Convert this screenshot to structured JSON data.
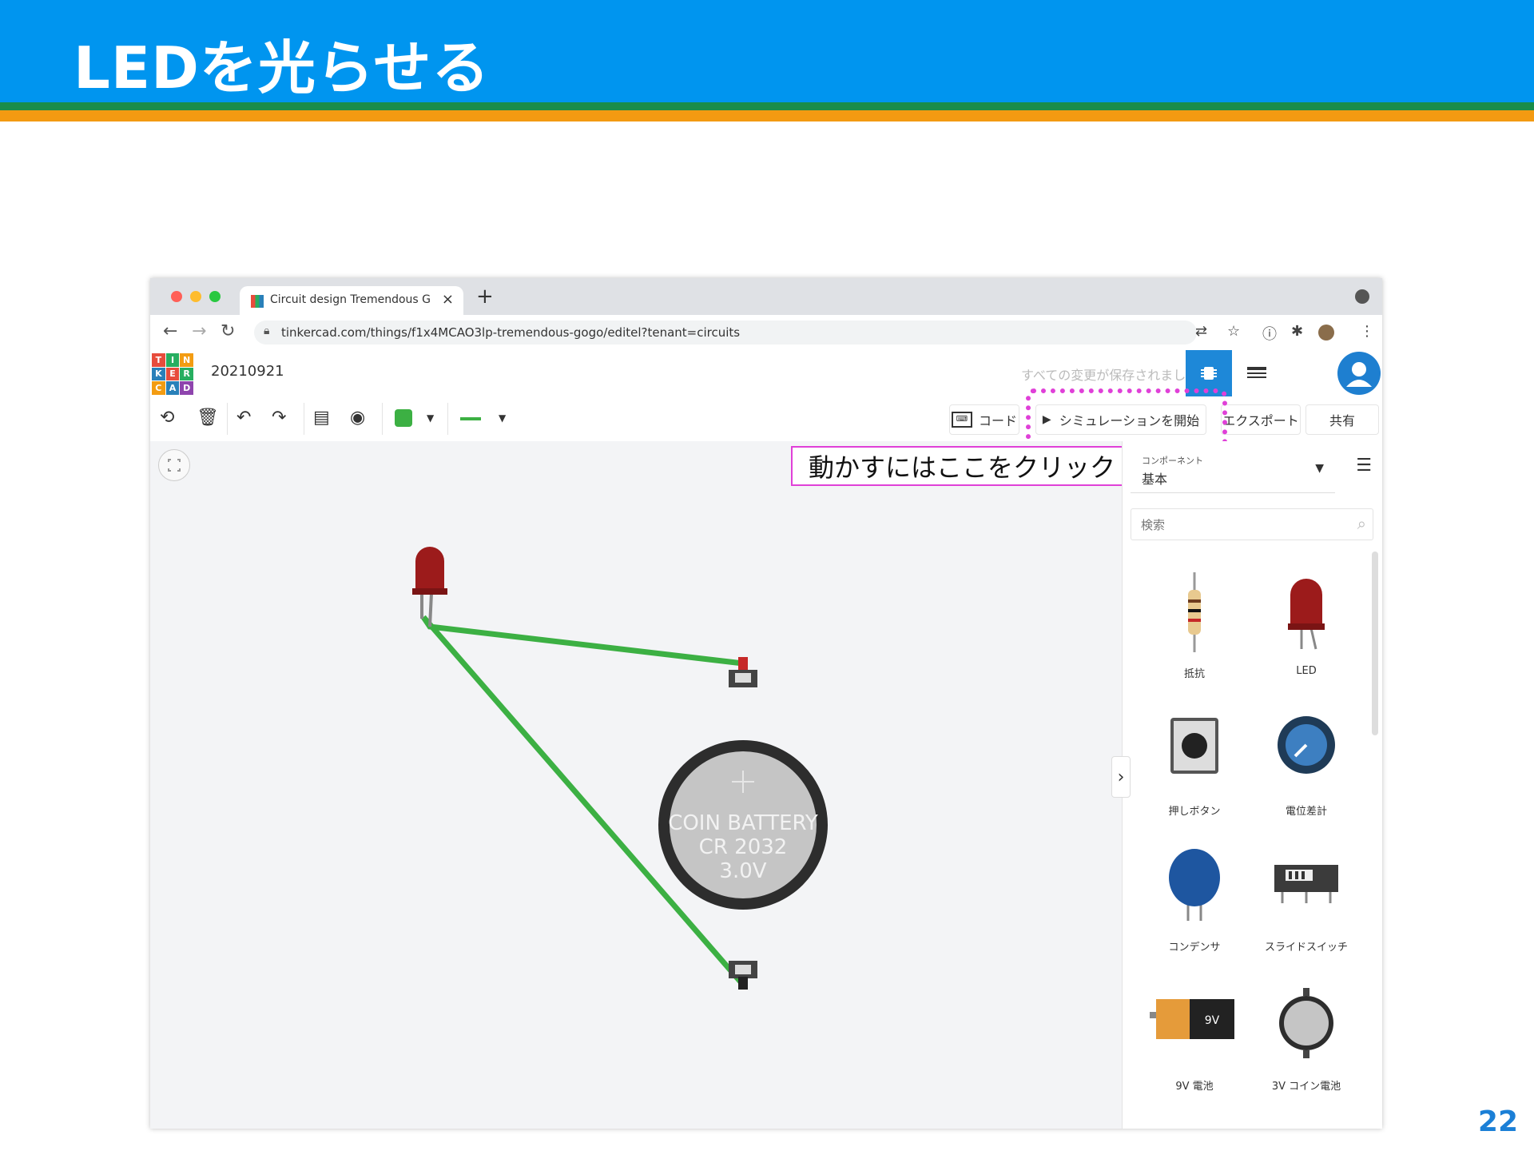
{
  "slide": {
    "title": "LEDを光らせる",
    "page_number": "22",
    "callout": "動かすにはここをクリック"
  },
  "browser": {
    "tab_title": "Circuit design Tremendous Go",
    "tab_close": "×",
    "new_tab": "+",
    "url": "tinkercad.com/things/f1x4MCAO3lp-tremendous-gogo/editel?tenant=circuits"
  },
  "app": {
    "logo_letters": [
      "T",
      "I",
      "N",
      "K",
      "E",
      "R",
      "C",
      "A",
      "D"
    ],
    "design_name": "20210921",
    "save_status": "すべての変更が保存されました",
    "toolbar": {
      "code_label": "コード",
      "simulate_label": "シミュレーションを開始",
      "export_label": "エクスポート",
      "share_label": "共有"
    },
    "colors": {
      "accent": "#1e7fd0",
      "wire": "#3cb043",
      "highlight": "#e040d8"
    }
  },
  "canvas": {
    "battery": {
      "line1": "COIN BATTERY",
      "line2": "CR 2032",
      "line3": "3.0V"
    }
  },
  "panel": {
    "component_caption": "コンポーネント",
    "component_value": "基本",
    "search_placeholder": "検索",
    "parts": [
      {
        "label": "抵抗",
        "icon": "resistor-icon"
      },
      {
        "label": "LED",
        "icon": "led-icon"
      },
      {
        "label": "押しボタン",
        "icon": "pushbutton-icon"
      },
      {
        "label": "電位差計",
        "icon": "potentiometer-icon"
      },
      {
        "label": "コンデンサ",
        "icon": "capacitor-icon"
      },
      {
        "label": "スライドスイッチ",
        "icon": "slide-switch-icon"
      },
      {
        "label": "9V 電池",
        "icon": "battery-9v-icon"
      },
      {
        "label": "3V コイン電池",
        "icon": "coin-battery-icon"
      }
    ],
    "battery_9v_text": "9V"
  }
}
